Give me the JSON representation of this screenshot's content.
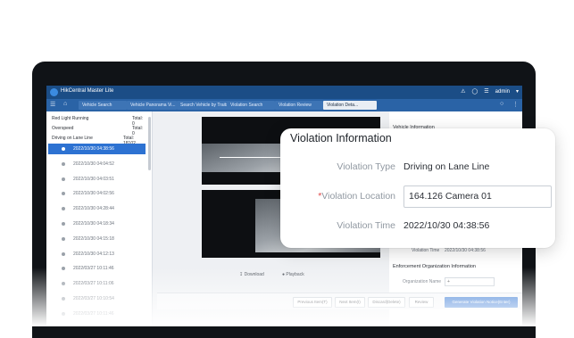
{
  "app": {
    "title": "HikCentral Master Lite",
    "user": "admin",
    "icons": [
      "menu-icon",
      "home-icon",
      "alarm-icon",
      "notification-icon",
      "settings-icon"
    ]
  },
  "tabs": [
    {
      "label": "Vehicle Search"
    },
    {
      "label": "Vehicle Panorama Vi..."
    },
    {
      "label": "Search Vehicle by Traits"
    },
    {
      "label": "Violation Search"
    },
    {
      "label": "Violation Review"
    },
    {
      "label": "Violation Deta..."
    }
  ],
  "sidebar": {
    "groups": [
      {
        "label": "Red Light Running",
        "total": "Total: 0"
      },
      {
        "label": "Overspeed",
        "total": "Total: 0"
      },
      {
        "label": "Driving on Lane Line",
        "total": "Total: 18102"
      }
    ],
    "records": [
      "2022/10/30 04:38:56",
      "2022/10/30 04:04:52",
      "2022/10/30 04:03:51",
      "2022/10/30 04:02:56",
      "2022/10/30 04:28:44",
      "2022/10/30 04:18:34",
      "2022/10/30 04:15:18",
      "2022/10/30 04:12:13",
      "2022/03/27 10:11:46",
      "2022/03/27 10:11:06",
      "2022/03/27 10:10:54",
      "2022/03/27 10:11:46"
    ]
  },
  "media": {
    "download": "Download",
    "playback": "Playback"
  },
  "right_panel": {
    "vehicle_info": "Vehicle Information",
    "violation_time_label": "Violation Time",
    "violation_time_value": "2022/10/30 04:38:56",
    "enforcement_title": "Enforcement Organization Information",
    "org_name_label": "Organization Name"
  },
  "buttons": {
    "previous": "Previous Item(T)",
    "next": "Next Item(I)",
    "discard": "Discard(Delete)",
    "review": "Review",
    "generate": "Generate Violation Notice(Enter)"
  },
  "callout": {
    "title": "Violation Information",
    "type_label": "Violation Type",
    "type_value": "Driving on Lane Line",
    "required_mark": "*",
    "location_label": "Violation Location",
    "location_value": "164.126 Camera 01",
    "time_label": "Violation Time",
    "time_value": "2022/10/30 04:38:56"
  },
  "colors": {
    "titlebar": "#1b4d86",
    "tabbar": "#2a63a6",
    "accent": "#2d72d2",
    "required": "#e04a4a"
  }
}
